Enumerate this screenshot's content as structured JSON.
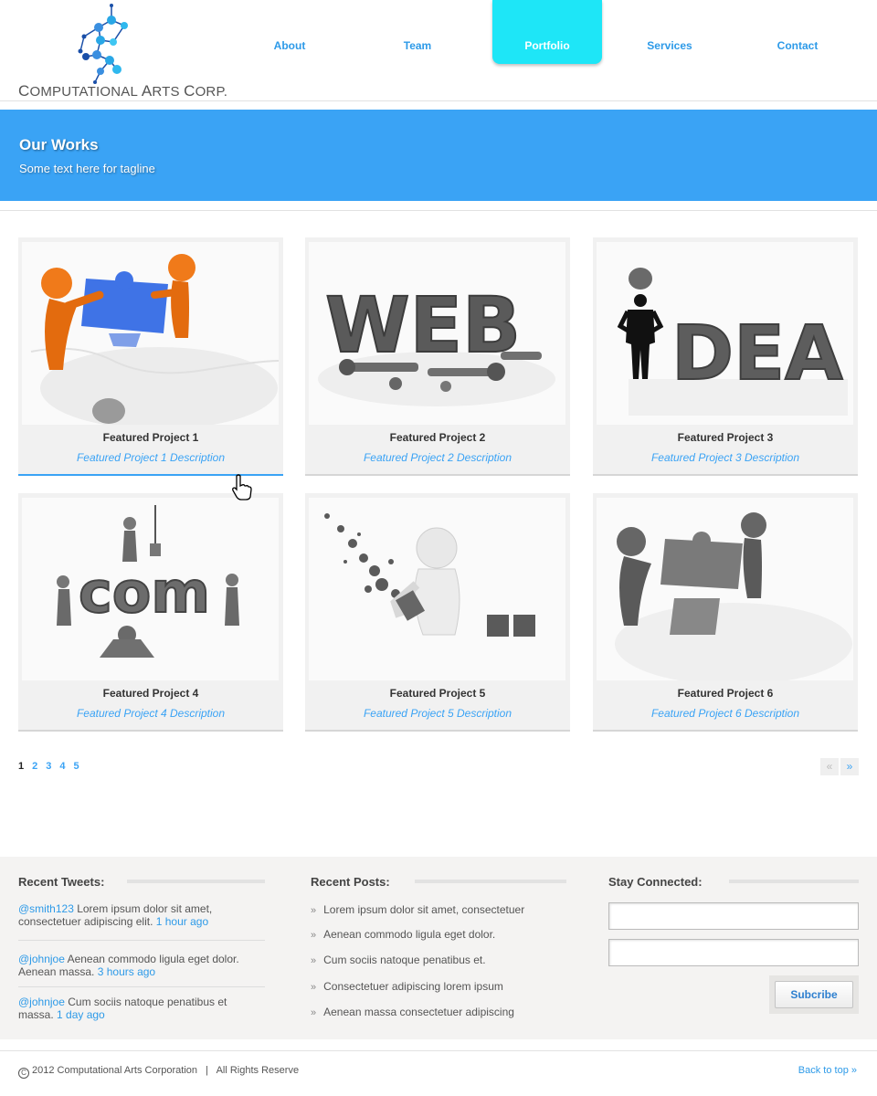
{
  "brand": {
    "name_first": "C",
    "name_rest": "OMPUTATIONAL ",
    "name_first2": "A",
    "name_rest2": "RTS ",
    "name_first3": "C",
    "name_rest3": "ORP."
  },
  "nav": [
    {
      "label": "About"
    },
    {
      "label": "Team"
    },
    {
      "label": "Portfolio",
      "active": true
    },
    {
      "label": "Services"
    },
    {
      "label": "Contact"
    }
  ],
  "banner": {
    "title": "Our Works",
    "tagline": "Some text here for tagline"
  },
  "projects": [
    {
      "title": "Featured Project 1",
      "description": "Featured Project 1 Description",
      "image": "orange-figures-puzzle"
    },
    {
      "title": "Featured Project 2",
      "description": "Featured Project 2 Description",
      "image": "web-letters-tools"
    },
    {
      "title": "Featured Project 3",
      "description": "Featured Project 3 Description",
      "image": "idea-businessman"
    },
    {
      "title": "Featured Project 4",
      "description": "Featured Project 4 Description",
      "image": "com-construction"
    },
    {
      "title": "Featured Project 5",
      "description": "Featured Project 5 Description",
      "image": "paint-splash-figure"
    },
    {
      "title": "Featured Project 6",
      "description": "Featured Project 6 Description",
      "image": "grey-figures-puzzle"
    }
  ],
  "pagination": {
    "pages": [
      "1",
      "2",
      "3",
      "4",
      "5"
    ],
    "current": "1",
    "prev": "«",
    "next": "»"
  },
  "tweets": {
    "heading": "Recent Tweets:",
    "items": [
      {
        "user": "@smith123",
        "text": " Lorem ipsum dolor sit amet, consectetuer adipiscing elit. ",
        "time": "1 hour ago"
      },
      {
        "user": "@johnjoe",
        "text": " Aenean commodo ligula eget dolor. Aenean massa. ",
        "time": "3 hours ago"
      },
      {
        "user": "@johnjoe",
        "text": " Cum sociis natoque penatibus et massa. ",
        "time": "1 day ago"
      }
    ]
  },
  "posts": {
    "heading": "Recent Posts:",
    "items": [
      "Lorem ipsum dolor sit amet, consectetuer",
      "Aenean commodo ligula eget dolor.",
      "Cum sociis natoque penatibus et.",
      "Consectetuer adipiscing lorem ipsum",
      "Aenean massa consectetuer adipiscing"
    ]
  },
  "connect": {
    "heading": "Stay Connected:",
    "name_value": "",
    "email_value": "",
    "button": "Subcribe"
  },
  "footer": {
    "copyright": "2012 Computational Arts Corporation   |   All Rights Reserve",
    "back_to_top": "Back to top  »"
  },
  "colors": {
    "accent": "#3aa3f5",
    "nav_active": "#1ee6f7",
    "link": "#2d9ae8"
  }
}
